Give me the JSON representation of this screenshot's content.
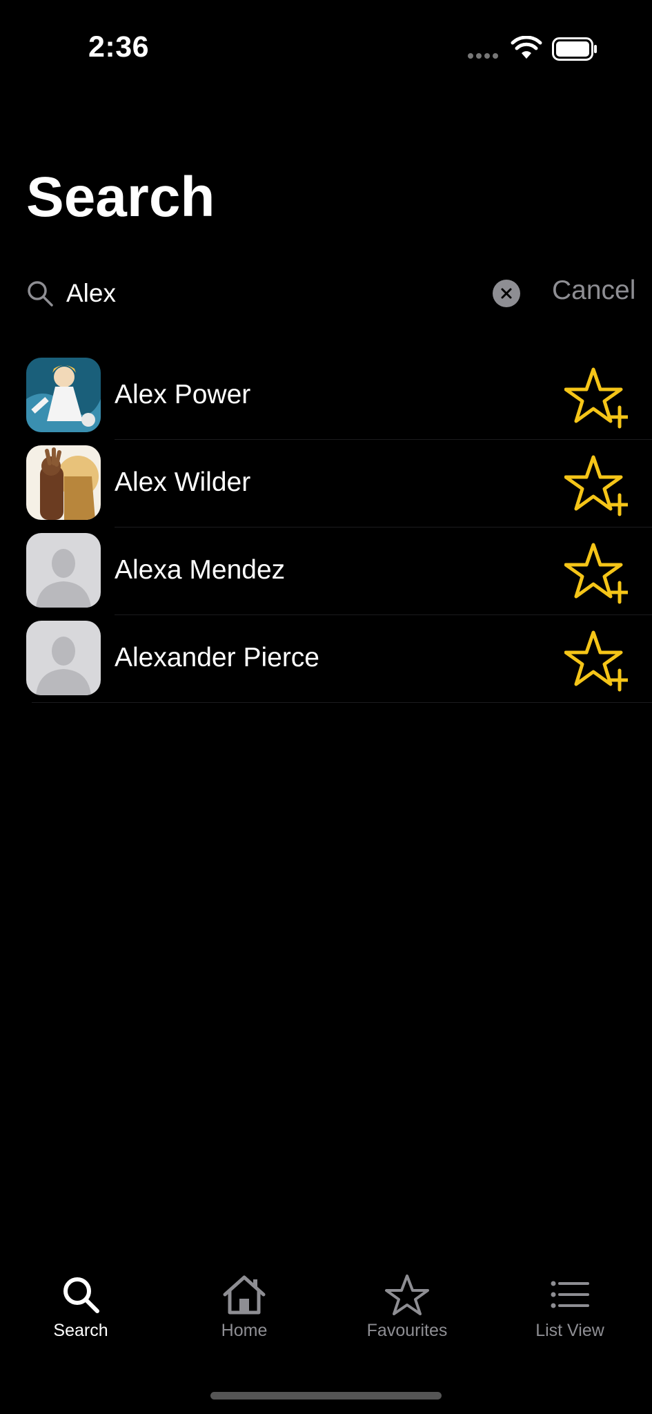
{
  "status_bar": {
    "time": "2:36"
  },
  "page": {
    "title": "Search"
  },
  "search": {
    "value": "Alex",
    "cancel_label": "Cancel"
  },
  "results": [
    {
      "name": "Alex Power",
      "avatar": "character-image"
    },
    {
      "name": "Alex Wilder",
      "avatar": "character-image"
    },
    {
      "name": "Alexa Mendez",
      "avatar": "placeholder-person"
    },
    {
      "name": "Alexander Pierce",
      "avatar": "placeholder-person"
    }
  ],
  "tab_bar": {
    "tabs": [
      {
        "label": "Search",
        "icon": "search-icon",
        "active": true
      },
      {
        "label": "Home",
        "icon": "home-icon",
        "active": false
      },
      {
        "label": "Favourites",
        "icon": "star-icon",
        "active": false
      },
      {
        "label": "List View",
        "icon": "list-icon",
        "active": false
      }
    ]
  },
  "colors": {
    "accent": "#F5C518",
    "inactive": "#8E8E93",
    "background": "#000000"
  }
}
